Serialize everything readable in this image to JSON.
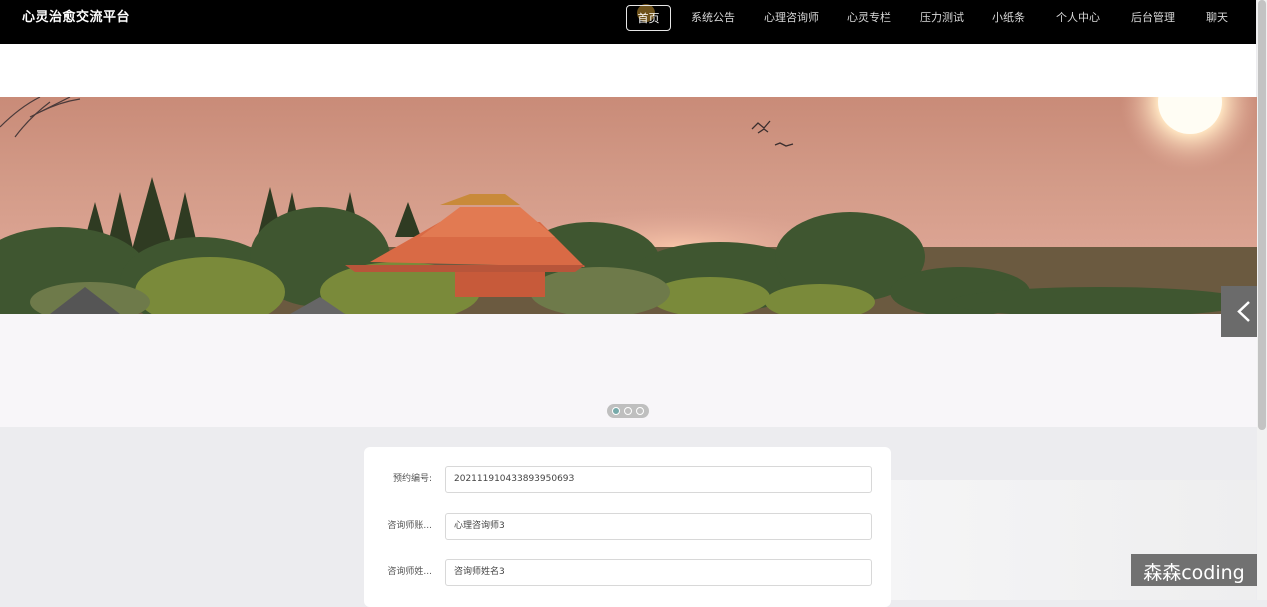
{
  "app": {
    "title": "心灵治愈交流平台"
  },
  "nav": {
    "items": [
      {
        "label": "首页",
        "active": true
      },
      {
        "label": "系统公告"
      },
      {
        "label": "心理咨询师"
      },
      {
        "label": "心灵专栏"
      },
      {
        "label": "压力测试"
      },
      {
        "label": "小纸条"
      },
      {
        "label": "个人中心"
      },
      {
        "label": "后台管理"
      },
      {
        "label": "聊天"
      }
    ]
  },
  "carousel": {
    "slide_count": 3,
    "active_index": 0,
    "prev_icon": "chevron-left-icon"
  },
  "form": {
    "fields": [
      {
        "label": "预约编号:",
        "value": "20211191043389395069З"
      },
      {
        "label": "咨询师账...",
        "value": "心理咨询师3"
      },
      {
        "label": "咨询师姓...",
        "value": "咨询师姓名3"
      }
    ]
  },
  "watermark": {
    "text": "森森coding"
  },
  "colors": {
    "topbar": "#000000",
    "banner_sky": "#d39b88",
    "page_bg": "#ececef"
  }
}
